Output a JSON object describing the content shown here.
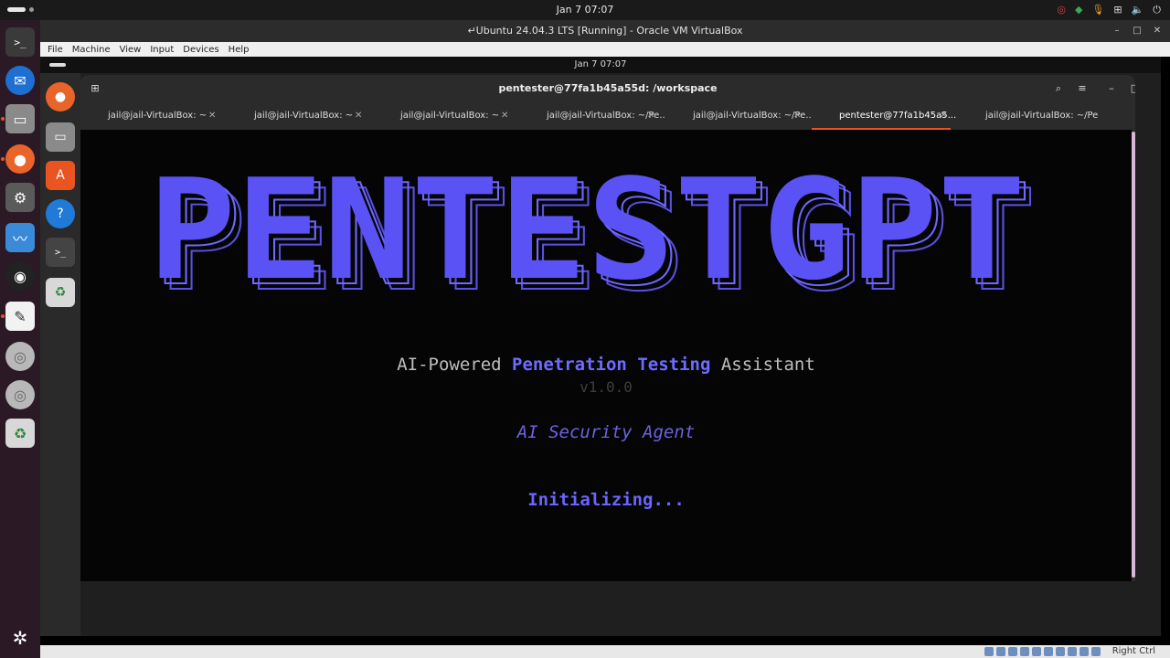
{
  "host": {
    "clock": "Jan 7  07:07",
    "vbox_title": "↵Ubuntu 24.04.3 LTS [Running] - Oracle VM VirtualBox",
    "menu": [
      "File",
      "Machine",
      "View",
      "Input",
      "Devices",
      "Help"
    ],
    "status_key": "Right Ctrl",
    "dock": [
      "terminal-icon",
      "thunderbird-icon",
      "files-icon",
      "firefox-icon",
      "settings-icon",
      "system-monitor-icon",
      "obs-icon",
      "text-editor-icon",
      "disc-icon",
      "disc-icon",
      "trash-icon",
      "ubuntu-logo-icon"
    ]
  },
  "guest": {
    "clock": "Jan 7  07:07",
    "dock": [
      "firefox-icon",
      "files-icon",
      "app-center-icon",
      "help-icon",
      "terminal-icon",
      "trash-icon"
    ]
  },
  "terminal": {
    "title": "pentester@77fa1b45a55d: /workspace",
    "tabs": [
      {
        "label": "jail@jail-VirtualBox: ~",
        "active": false
      },
      {
        "label": "jail@jail-VirtualBox: ~",
        "active": false
      },
      {
        "label": "jail@jail-VirtualBox: ~",
        "active": false
      },
      {
        "label": "jail@jail-VirtualBox: ~/Pe...",
        "active": false
      },
      {
        "label": "jail@jail-VirtualBox: ~/Pe...",
        "active": false
      },
      {
        "label": "pentester@77fa1b45a5...",
        "active": true
      },
      {
        "label": "jail@jail-VirtualBox: ~/Pe...",
        "active": false
      }
    ],
    "banner": "PENTESTGPT",
    "tagline": {
      "part1": "AI-Powered ",
      "highlight1": "Penetration",
      "space": " ",
      "highlight2": "Testing",
      "part2": " Assistant"
    },
    "version": "v1.0.0",
    "agent": "AI Security Agent",
    "status": "Initializing..."
  },
  "colors": {
    "banner_fill": "#5b52f5",
    "banner_outline": "#6e68ff",
    "accent": "#e95420"
  }
}
